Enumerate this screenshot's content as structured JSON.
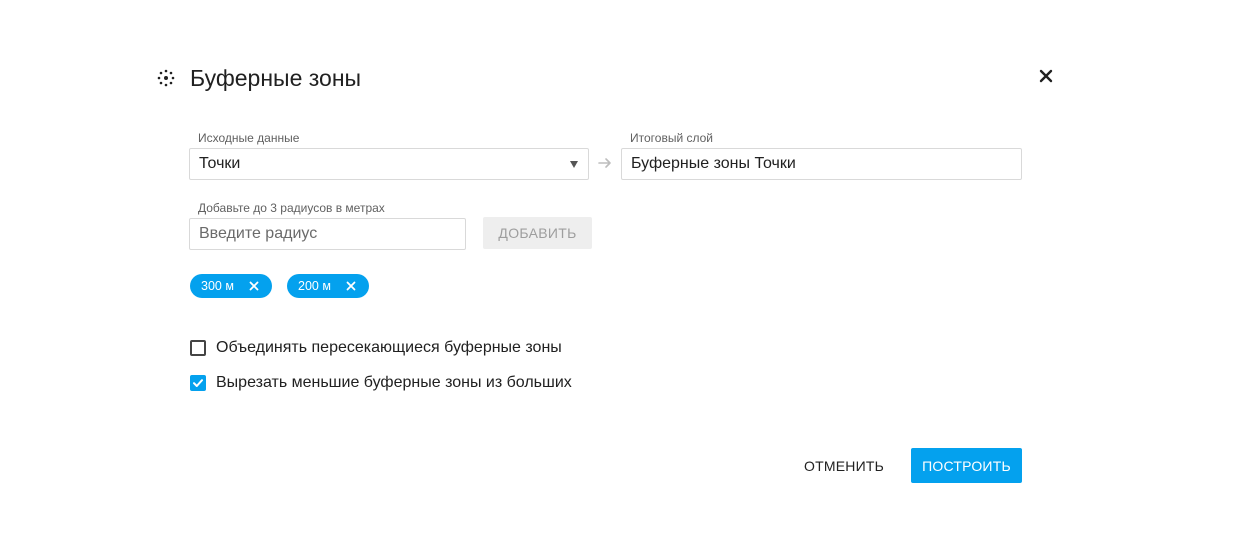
{
  "dialog": {
    "title": "Буферные зоны",
    "title_icon": "buffer-circle-icon",
    "close_icon": "close-icon"
  },
  "source": {
    "label": "Исходные данные",
    "selected_value": "Точки"
  },
  "result": {
    "label": "Итоговый слой",
    "value": "Буферные зоны Точки"
  },
  "radius": {
    "label": "Добавьте до 3 радиусов в метрах",
    "placeholder": "Введите радиус",
    "value": "",
    "add_label": "ДОБАВИТЬ"
  },
  "chips": [
    {
      "label": "300 м"
    },
    {
      "label": "200 м"
    }
  ],
  "options": [
    {
      "label": "Объединять пересекающиеся буферные зоны",
      "checked": false
    },
    {
      "label": "Вырезать меньшие буферные зоны из больших",
      "checked": true
    }
  ],
  "footer": {
    "cancel_label": "ОТМЕНИТЬ",
    "build_label": "ПОСТРОИТЬ"
  },
  "colors": {
    "accent": "#04a1ee",
    "disabled_bg": "#eeeeee",
    "border": "#d9d9d9"
  }
}
